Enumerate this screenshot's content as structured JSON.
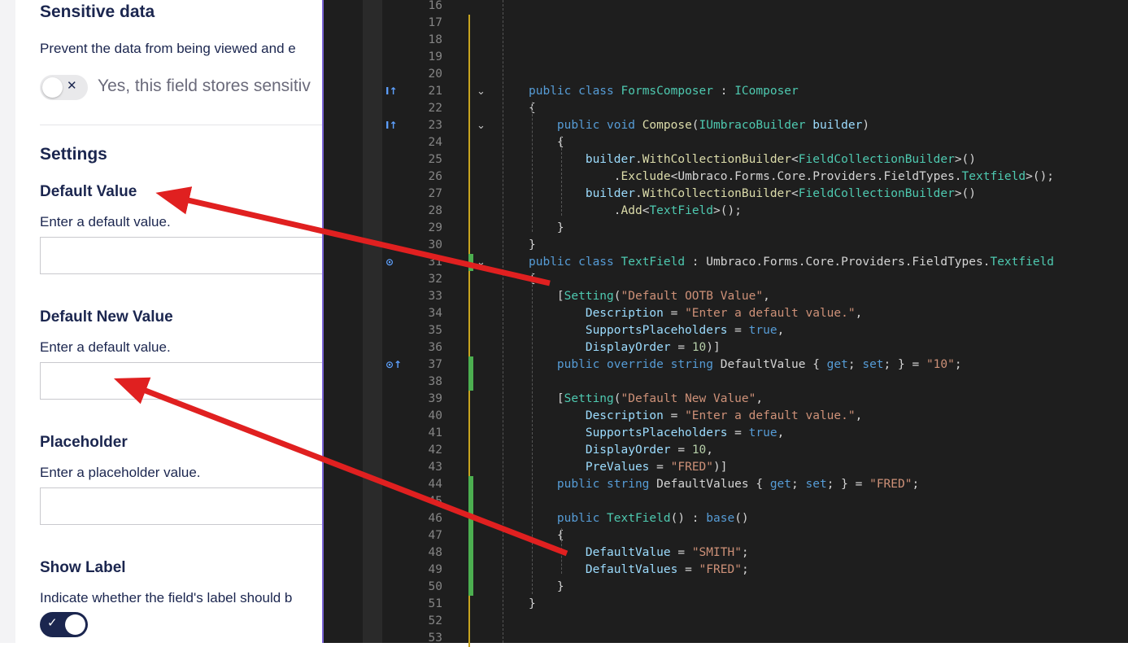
{
  "form": {
    "sensitive": {
      "title": "Sensitive data",
      "description": "Prevent the data from being viewed and e",
      "toggle_label": "Yes, this field stores sensitiv",
      "toggle_mark": "✕"
    },
    "settings_title": "Settings",
    "default_value": {
      "label": "Default Value",
      "description": "Enter a default value.",
      "value": ""
    },
    "default_new_value": {
      "label": "Default New Value",
      "description": "Enter a default value.",
      "value": ""
    },
    "placeholder": {
      "label": "Placeholder",
      "description": "Enter a placeholder value.",
      "value": ""
    },
    "show_label": {
      "label": "Show Label",
      "description": "Indicate whether the field's label should b",
      "toggle_mark": "✓"
    }
  },
  "editor": {
    "lines": [
      {
        "n": "16",
        "code": []
      },
      {
        "n": "17",
        "code": []
      },
      {
        "n": "18",
        "code": []
      },
      {
        "n": "19",
        "code": []
      },
      {
        "n": "20",
        "code": []
      },
      {
        "n": "21",
        "code": [
          [
            "kw",
            "public "
          ],
          [
            "kw",
            "class "
          ],
          [
            "ty",
            "FormsComposer"
          ],
          [
            "pl",
            " : "
          ],
          [
            "ty",
            "IComposer"
          ]
        ]
      },
      {
        "n": "22",
        "code": [
          [
            "pl",
            "{"
          ]
        ]
      },
      {
        "n": "23",
        "code": [
          [
            "pl",
            "    "
          ],
          [
            "kw",
            "public "
          ],
          [
            "kw",
            "void "
          ],
          [
            "fn",
            "Compose"
          ],
          [
            "pl",
            "("
          ],
          [
            "ty",
            "IUmbracoBuilder "
          ],
          [
            "id",
            "builder"
          ],
          [
            "pl",
            ")"
          ]
        ]
      },
      {
        "n": "24",
        "code": [
          [
            "pl",
            "    {"
          ]
        ]
      },
      {
        "n": "25",
        "code": [
          [
            "pl",
            "        "
          ],
          [
            "id",
            "builder"
          ],
          [
            "pl",
            "."
          ],
          [
            "fn",
            "WithCollectionBuilder"
          ],
          [
            "pl",
            "<"
          ],
          [
            "ty",
            "FieldCollectionBuilder"
          ],
          [
            "pl",
            ">()"
          ]
        ]
      },
      {
        "n": "26",
        "code": [
          [
            "pl",
            "            ."
          ],
          [
            "fn",
            "Exclude"
          ],
          [
            "pl",
            "<Umbraco.Forms.Core.Providers.FieldTypes."
          ],
          [
            "ty",
            "Textfield"
          ],
          [
            "pl",
            ">();"
          ]
        ]
      },
      {
        "n": "27",
        "code": [
          [
            "pl",
            "        "
          ],
          [
            "id",
            "builder"
          ],
          [
            "pl",
            "."
          ],
          [
            "fn",
            "WithCollectionBuilder"
          ],
          [
            "pl",
            "<"
          ],
          [
            "ty",
            "FieldCollectionBuilder"
          ],
          [
            "pl",
            ">()"
          ]
        ]
      },
      {
        "n": "28",
        "code": [
          [
            "pl",
            "            ."
          ],
          [
            "fn",
            "Add"
          ],
          [
            "pl",
            "<"
          ],
          [
            "ty",
            "TextField"
          ],
          [
            "pl",
            ">();"
          ]
        ]
      },
      {
        "n": "29",
        "code": [
          [
            "pl",
            "    }"
          ]
        ]
      },
      {
        "n": "30",
        "code": [
          [
            "pl",
            "}"
          ]
        ]
      },
      {
        "n": "31",
        "code": [
          [
            "kw",
            "public "
          ],
          [
            "kw",
            "class "
          ],
          [
            "ty",
            "TextField"
          ],
          [
            "pl",
            " : Umbraco.Forms.Core.Providers.FieldTypes."
          ],
          [
            "ty",
            "Textfield"
          ]
        ]
      },
      {
        "n": "32",
        "code": [
          [
            "pl",
            "{"
          ]
        ]
      },
      {
        "n": "33",
        "code": [
          [
            "pl",
            "    ["
          ],
          [
            "ty",
            "Setting"
          ],
          [
            "pl",
            "("
          ],
          [
            "str",
            "\"Default OOTB Value\""
          ],
          [
            "pl",
            ","
          ]
        ]
      },
      {
        "n": "34",
        "code": [
          [
            "pl",
            "        "
          ],
          [
            "id",
            "Description"
          ],
          [
            "pl",
            " = "
          ],
          [
            "str",
            "\"Enter a default value.\""
          ],
          [
            "pl",
            ","
          ]
        ]
      },
      {
        "n": "35",
        "code": [
          [
            "pl",
            "        "
          ],
          [
            "id",
            "SupportsPlaceholders"
          ],
          [
            "pl",
            " = "
          ],
          [
            "kw",
            "true"
          ],
          [
            "pl",
            ","
          ]
        ]
      },
      {
        "n": "36",
        "code": [
          [
            "pl",
            "        "
          ],
          [
            "id",
            "DisplayOrder"
          ],
          [
            "pl",
            " = "
          ],
          [
            "num",
            "10"
          ],
          [
            "pl",
            ")]"
          ]
        ]
      },
      {
        "n": "37",
        "code": [
          [
            "pl",
            "    "
          ],
          [
            "kw",
            "public "
          ],
          [
            "kw",
            "override "
          ],
          [
            "kw",
            "string "
          ],
          [
            "pl",
            "DefaultValue { "
          ],
          [
            "kw",
            "get"
          ],
          [
            "pl",
            "; "
          ],
          [
            "kw",
            "set"
          ],
          [
            "pl",
            "; } = "
          ],
          [
            "str",
            "\"10\""
          ],
          [
            "pl",
            ";"
          ]
        ]
      },
      {
        "n": "38",
        "code": []
      },
      {
        "n": "39",
        "code": [
          [
            "pl",
            "    ["
          ],
          [
            "ty",
            "Setting"
          ],
          [
            "pl",
            "("
          ],
          [
            "str",
            "\"Default New Value\""
          ],
          [
            "pl",
            ","
          ]
        ]
      },
      {
        "n": "40",
        "code": [
          [
            "pl",
            "        "
          ],
          [
            "id",
            "Description"
          ],
          [
            "pl",
            " = "
          ],
          [
            "str",
            "\"Enter a default value.\""
          ],
          [
            "pl",
            ","
          ]
        ]
      },
      {
        "n": "41",
        "code": [
          [
            "pl",
            "        "
          ],
          [
            "id",
            "SupportsPlaceholders"
          ],
          [
            "pl",
            " = "
          ],
          [
            "kw",
            "true"
          ],
          [
            "pl",
            ","
          ]
        ]
      },
      {
        "n": "42",
        "code": [
          [
            "pl",
            "        "
          ],
          [
            "id",
            "DisplayOrder"
          ],
          [
            "pl",
            " = "
          ],
          [
            "num",
            "10"
          ],
          [
            "pl",
            ","
          ]
        ]
      },
      {
        "n": "43",
        "code": [
          [
            "pl",
            "        "
          ],
          [
            "id",
            "PreValues"
          ],
          [
            "pl",
            " = "
          ],
          [
            "str",
            "\"FRED\""
          ],
          [
            "pl",
            ")]"
          ]
        ]
      },
      {
        "n": "44",
        "code": [
          [
            "pl",
            "    "
          ],
          [
            "kw",
            "public "
          ],
          [
            "kw",
            "string "
          ],
          [
            "pl",
            "DefaultValues { "
          ],
          [
            "kw",
            "get"
          ],
          [
            "pl",
            "; "
          ],
          [
            "kw",
            "set"
          ],
          [
            "pl",
            "; } = "
          ],
          [
            "str",
            "\"FRED\""
          ],
          [
            "pl",
            ";"
          ]
        ]
      },
      {
        "n": "45",
        "code": []
      },
      {
        "n": "46",
        "code": [
          [
            "pl",
            "    "
          ],
          [
            "kw",
            "public "
          ],
          [
            "ty",
            "TextField"
          ],
          [
            "pl",
            "() : "
          ],
          [
            "kw",
            "base"
          ],
          [
            "pl",
            "()"
          ]
        ]
      },
      {
        "n": "47",
        "code": [
          [
            "pl",
            "    {"
          ]
        ]
      },
      {
        "n": "48",
        "code": [
          [
            "pl",
            "        "
          ],
          [
            "id",
            "DefaultValue"
          ],
          [
            "pl",
            " = "
          ],
          [
            "str",
            "\"SMITH\""
          ],
          [
            "pl",
            ";"
          ]
        ]
      },
      {
        "n": "49",
        "code": [
          [
            "pl",
            "        "
          ],
          [
            "id",
            "DefaultValues"
          ],
          [
            "pl",
            " = "
          ],
          [
            "str",
            "\"FRED\""
          ],
          [
            "pl",
            ";"
          ]
        ]
      },
      {
        "n": "50",
        "code": [
          [
            "pl",
            "    }"
          ]
        ]
      },
      {
        "n": "51",
        "code": [
          [
            "pl",
            "}"
          ]
        ]
      },
      {
        "n": "52",
        "code": []
      },
      {
        "n": "53",
        "code": []
      }
    ]
  }
}
